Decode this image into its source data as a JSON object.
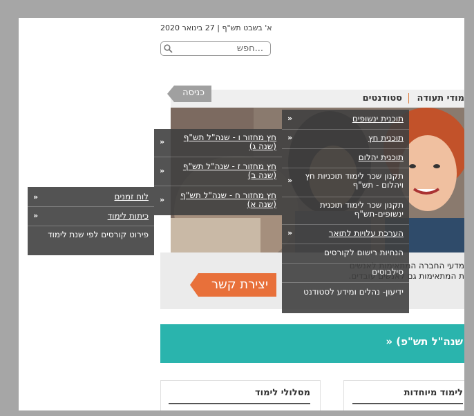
{
  "header": {
    "date": "א' בשבט תש\"ף | 27 בינואר 2020",
    "search_placeholder": "חפש..."
  },
  "topbar": {
    "tab_cert": "מודי תעודה",
    "tab_students": "סטודנטים",
    "enter_label": "כניסה"
  },
  "notice": {
    "line1": "מדעי החברה המתאימות לאנשים",
    "line2": "ת המתאימות גם לאנשים עובדים."
  },
  "contact_label": "יצירת קשר",
  "teal_band": "» (שנה\"ל תש\"פ",
  "cards": {
    "left": "מסלולי לימוד",
    "right": "לימוד מיוחדות"
  },
  "menu_main": {
    "items": [
      {
        "label": "תוכנית ינשופים",
        "link": true,
        "chevron": true
      },
      {
        "label": "תוכנית חץ",
        "link": true,
        "chevron": true
      },
      {
        "label": "תוכנית יהלום",
        "link": true,
        "chevron": false
      },
      {
        "label": "תקנון שכר לימוד תוכניות חץ ויהלום - תש\"ף",
        "link": false,
        "chevron": true
      },
      {
        "label": "תקנון שכר לימוד תוכנית ינשופים-תש\"ף",
        "link": false,
        "chevron": false
      },
      {
        "label": "הערכת עלויות לתואר",
        "link": true,
        "chevron": true
      },
      {
        "label": "הנחיות רישום לקורסים",
        "link": false,
        "chevron": false
      },
      {
        "label": "סילבוסים",
        "link": false,
        "chevron": false
      },
      {
        "label": "ידיעון- נהלים ומידע לסטודנט",
        "link": false,
        "chevron": false
      }
    ]
  },
  "menu_sub": {
    "items": [
      {
        "label": "חץ מחזור ו - שנה\"ל תש\"ף (שנה ג)"
      },
      {
        "label": "חץ מחזור ז - שנה\"ל תש\"ף (שנה ב)"
      },
      {
        "label": "חץ מחזור ח - שנה\"ל תש\"ף (שנה א)"
      }
    ]
  },
  "menu_third": {
    "items": [
      {
        "label": "לוח זמנים",
        "link": true
      },
      {
        "label": "כיתות לימוד",
        "link": true
      },
      {
        "label": "פירוט קורסים לפי שנת לימוד",
        "link": false
      }
    ]
  },
  "icons": {
    "chevron": "»",
    "search": "search-icon"
  },
  "colors": {
    "teal": "#2ab4ad",
    "orange": "#e8703a",
    "menu_bg": "#404040",
    "enter_btn": "#a0a0a0"
  }
}
